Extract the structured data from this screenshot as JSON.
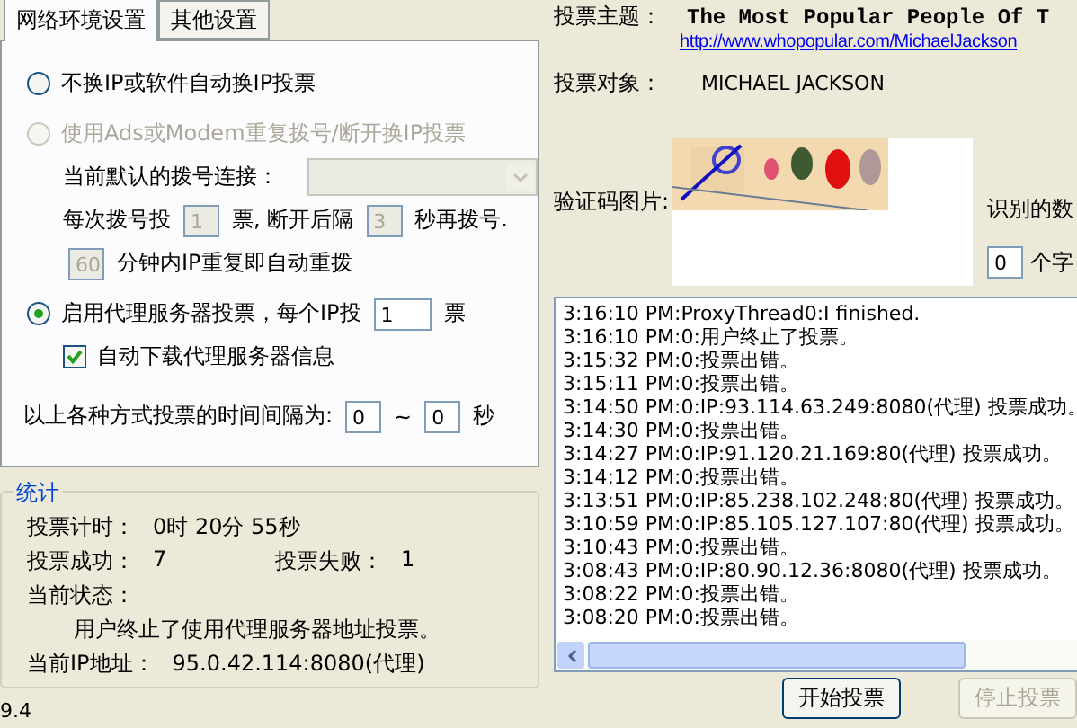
{
  "tabs": [
    {
      "label": "网络环境设置",
      "selected": true
    },
    {
      "label": "其他设置",
      "selected": false
    }
  ],
  "options": [
    {
      "kind": "option",
      "parts": [
        {
          "kind": "radio",
          "label": "不换IP或软件自动换IP投票",
          "selected": false,
          "disabled": false
        }
      ]
    },
    {
      "kind": "option",
      "parts": [
        {
          "kind": "radio",
          "label": "使用Ads或Modem重复拨号/断开换IP投票",
          "selected": false,
          "disabled": true
        }
      ]
    },
    {
      "kind": "sub",
      "parts": [
        {
          "kind": "text",
          "text": "当前默认的拨号连接："
        },
        {
          "kind": "combo",
          "disabled": true
        }
      ]
    },
    {
      "kind": "sub",
      "parts": [
        {
          "kind": "text",
          "text": "每次拨号投"
        },
        {
          "kind": "field",
          "value": "1",
          "disabled": true
        },
        {
          "kind": "text",
          "text": "票, 断开后隔"
        },
        {
          "kind": "field",
          "value": "3",
          "disabled": true
        },
        {
          "kind": "text",
          "text": "秒再拨号."
        }
      ]
    },
    {
      "kind": "sub",
      "parts": [
        {
          "kind": "field",
          "value": "60",
          "disabled": true
        },
        {
          "kind": "text",
          "text": "分钟内IP重复即自动重拨"
        }
      ]
    },
    {
      "kind": "option",
      "parts": [
        {
          "kind": "radio",
          "label": "启用代理服务器投票，每个IP投",
          "selected": true,
          "disabled": false
        },
        {
          "kind": "field",
          "value": "1",
          "disabled": false,
          "wide": true
        },
        {
          "kind": "text",
          "text": "票"
        }
      ]
    },
    {
      "kind": "sub",
      "parts": [
        {
          "kind": "checkbox",
          "label": "自动下载代理服务器信息",
          "checked": true
        }
      ]
    },
    {
      "kind": "setting",
      "parts": [
        {
          "kind": "text",
          "text": "以上各种方式投票的时间间隔为:"
        },
        {
          "kind": "field",
          "value": "0",
          "disabled": false
        },
        {
          "kind": "text",
          "text": "~"
        },
        {
          "kind": "field",
          "value": "0",
          "disabled": false
        },
        {
          "kind": "text",
          "text": "秒"
        }
      ]
    }
  ],
  "stats": {
    "title": "统计",
    "rows": [
      {
        "kind": "pairs",
        "items": [
          {
            "label": "投票计时：",
            "value": "0时 20分 55秒"
          }
        ]
      },
      {
        "kind": "pairs",
        "items": [
          {
            "label": "投票成功：",
            "value": "7"
          },
          {
            "label": "投票失败：",
            "value": "1"
          }
        ]
      },
      {
        "kind": "pairs",
        "items": [
          {
            "label": "当前状态："
          }
        ]
      },
      {
        "kind": "note",
        "text": "用户终止了使用代理服务器地址投票。"
      },
      {
        "kind": "pairs",
        "items": [
          {
            "label": "当前IP地址：",
            "value": "95.0.42.114:8080(代理)"
          }
        ]
      }
    ]
  },
  "version": "9.4",
  "vote": {
    "topic_label": "投票主题：",
    "topic": "The Most Popular People Of T",
    "url": "http://www.whopopular.com/MichaelJackson",
    "target_label": "投票对象：",
    "target": "MICHAEL JACKSON",
    "captcha_label": "验证码图片:",
    "recognized_label": "识别的数",
    "count": "0",
    "count_suffix": "个字"
  },
  "log": [
    "3:16:10 PM:ProxyThread0:I finished.",
    "3:16:10 PM:0:用户终止了投票。",
    "3:15:32 PM:0:投票出错。",
    "3:15:11 PM:0:投票出错。",
    "3:14:50 PM:0:IP:93.114.63.249:8080(代理) 投票成功。",
    "3:14:30 PM:0:投票出错。",
    "3:14:27 PM:0:IP:91.120.21.169:80(代理) 投票成功。",
    "3:14:12 PM:0:投票出错。",
    "3:13:51 PM:0:IP:85.238.102.248:80(代理) 投票成功。",
    "3:10:59 PM:0:IP:85.105.127.107:80(代理) 投票成功。",
    "3:10:43 PM:0:投票出错。",
    "3:08:43 PM:0:IP:80.90.12.36:8080(代理) 投票成功。",
    "3:08:22 PM:0:投票出错。",
    "3:08:20 PM:0:投票出错。"
  ],
  "buttons": [
    {
      "label": "开始投票",
      "disabled": false
    },
    {
      "label": "停止投票",
      "disabled": true
    }
  ]
}
